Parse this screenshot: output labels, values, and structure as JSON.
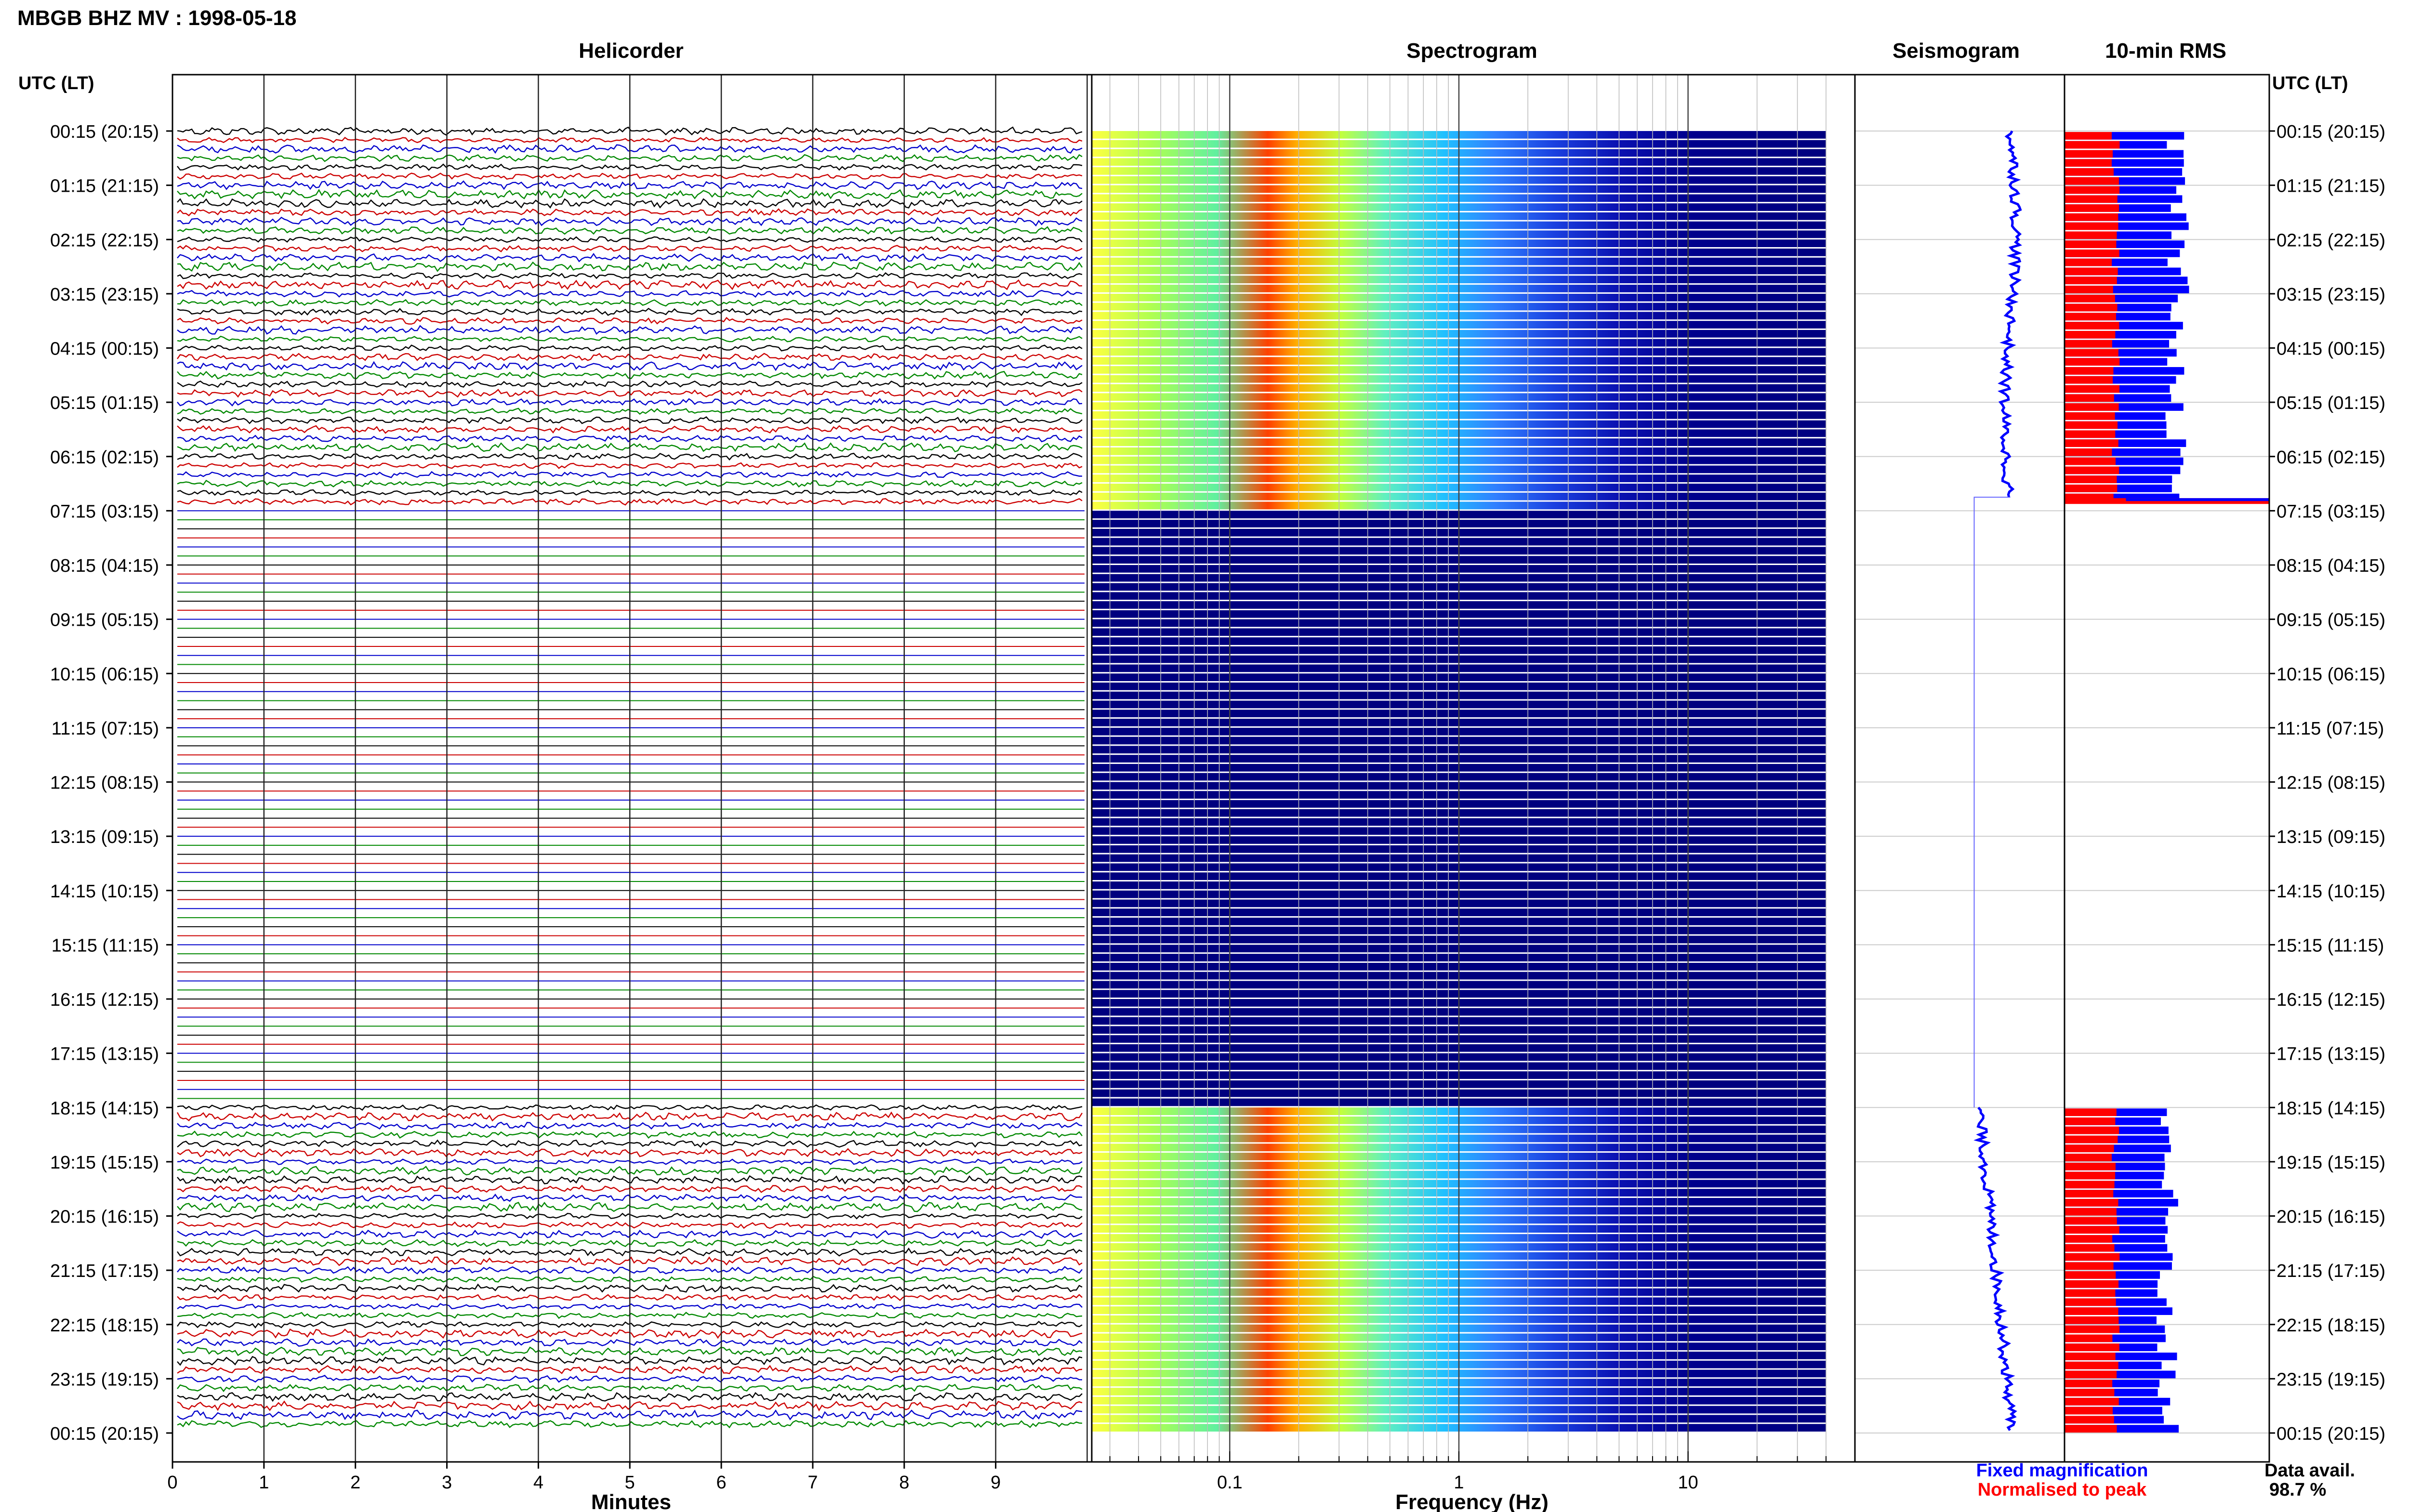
{
  "header": {
    "station_title": "MBGB BHZ MV : 1998-05-18"
  },
  "panels": {
    "helicorder_title": "Helicorder",
    "spectrogram_title": "Spectrogram",
    "seismogram_title": "Seismogram",
    "rms_title": "10-min RMS"
  },
  "axes": {
    "left_time_label": "UTC (LT)",
    "right_time_label": "UTC (LT)",
    "minutes_label": "Minutes",
    "frequency_label": "Frequency (Hz)",
    "minute_ticks": [
      "0",
      "1",
      "2",
      "3",
      "4",
      "5",
      "6",
      "7",
      "8",
      "9"
    ],
    "frequency_ticks": [
      "0.1",
      "1",
      "10"
    ]
  },
  "legend": {
    "fixed_magnification": "Fixed magnification",
    "normalised_to_peak": "Normalised to peak",
    "data_avail_label": "Data avail.",
    "data_avail_value": "98.7 %"
  },
  "colors": {
    "fixed_magnification": "#0000ff",
    "normalised_to_peak": "#ff0000",
    "trace_black": "#000000",
    "trace_red": "#cc0000",
    "trace_blue": "#0000cc",
    "trace_green": "#008800",
    "spectrogram_background": "#00007f"
  },
  "chart_data": {
    "type": "heatmap",
    "title": "MBGB BHZ MV : 1998-05-18",
    "time_labels": [
      "00:15 (20:15)",
      "01:15 (21:15)",
      "02:15 (22:15)",
      "03:15 (23:15)",
      "04:15 (00:15)",
      "05:15 (01:15)",
      "06:15 (02:15)",
      "07:15 (03:15)",
      "08:15 (04:15)",
      "09:15 (05:15)",
      "10:15 (06:15)",
      "11:15 (07:15)",
      "12:15 (08:15)",
      "13:15 (09:15)",
      "14:15 (10:15)",
      "15:15 (11:15)",
      "16:15 (12:15)",
      "17:15 (13:15)",
      "18:15 (14:15)",
      "19:15 (15:15)",
      "20:15 (16:15)",
      "21:15 (17:15)",
      "22:15 (18:15)",
      "23:15 (19:15)",
      "00:15 (20:15)"
    ],
    "helicorder": {
      "xlabel": "Minutes",
      "xlim": [
        0,
        10
      ],
      "rows_per_hour": 6,
      "trace_color_cycle": [
        "black",
        "red",
        "blue",
        "green"
      ],
      "active_until_hour": 7.0,
      "active_from_hour": 18.0
    },
    "spectrogram": {
      "xlabel": "Frequency (Hz)",
      "xscale": "log",
      "xlim": [
        0.025,
        40
      ],
      "peak_band_hz": [
        0.2,
        0.3
      ],
      "active_until_hour": 7.0,
      "active_from_hour": 18.0
    },
    "seismogram_data_avail": "98.7 %",
    "rms_segments": [
      {
        "from_hour": 0.0,
        "to_hour": 6.75,
        "normalised_fraction": 0.25,
        "fixed_fraction": 0.55
      },
      {
        "from_hour": 18.0,
        "to_hour": 24.0,
        "normalised_fraction": 0.25,
        "fixed_fraction": 0.5
      }
    ]
  }
}
